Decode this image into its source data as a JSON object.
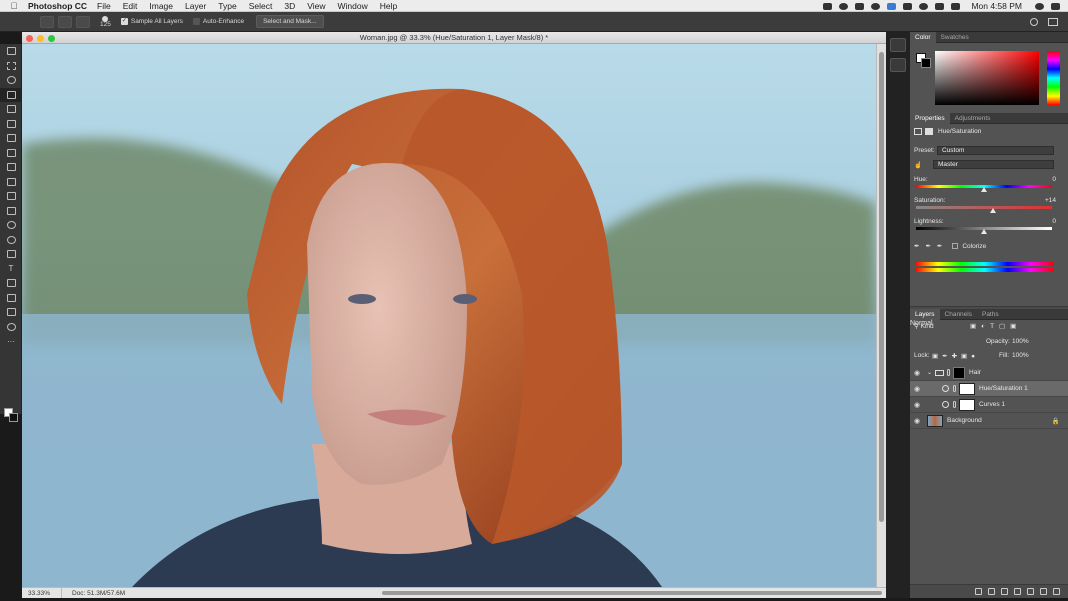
{
  "menubar": {
    "app_name": "Photoshop CC",
    "items": [
      "File",
      "Edit",
      "Image",
      "Layer",
      "Type",
      "Select",
      "3D",
      "View",
      "Window",
      "Help"
    ],
    "clock": "Mon 4:58 PM"
  },
  "options_bar": {
    "brush_size": "125",
    "sample_all_layers": "Sample All Layers",
    "auto_enhance": "Auto-Enhance",
    "select_and_mask": "Select and Mask..."
  },
  "document": {
    "title": "Woman.jpg @ 33.3% (Hue/Saturation 1, Layer Mask/8) *",
    "zoom": "33.33%",
    "doc_size": "Doc: 51.3M/57.6M"
  },
  "color_panel": {
    "tabs": [
      "Color",
      "Swatches"
    ],
    "foreground": "#ffffff",
    "background": "#000000"
  },
  "properties_panel": {
    "tabs": [
      "Properties",
      "Adjustments"
    ],
    "adjustment_name": "Hue/Saturation",
    "preset_label": "Preset:",
    "preset_value": "Custom",
    "channel_value": "Master",
    "hue_label": "Hue:",
    "hue_value": "0",
    "saturation_label": "Saturation:",
    "saturation_value": "+14",
    "lightness_label": "Lightness:",
    "lightness_value": "0",
    "colorize_label": "Colorize"
  },
  "layers_panel": {
    "tabs": [
      "Layers",
      "Channels",
      "Paths"
    ],
    "filter_kind": "Kind",
    "blend_mode": "Normal",
    "opacity_label": "Opacity:",
    "opacity_value": "100%",
    "lock_label": "Lock:",
    "fill_label": "Fill:",
    "fill_value": "100%",
    "layers": [
      {
        "name": "Hair",
        "type": "group"
      },
      {
        "name": "Hue/Saturation 1",
        "type": "adjustment",
        "selected": true
      },
      {
        "name": "Curves 1",
        "type": "adjustment"
      },
      {
        "name": "Background",
        "type": "image",
        "locked": true
      }
    ]
  }
}
